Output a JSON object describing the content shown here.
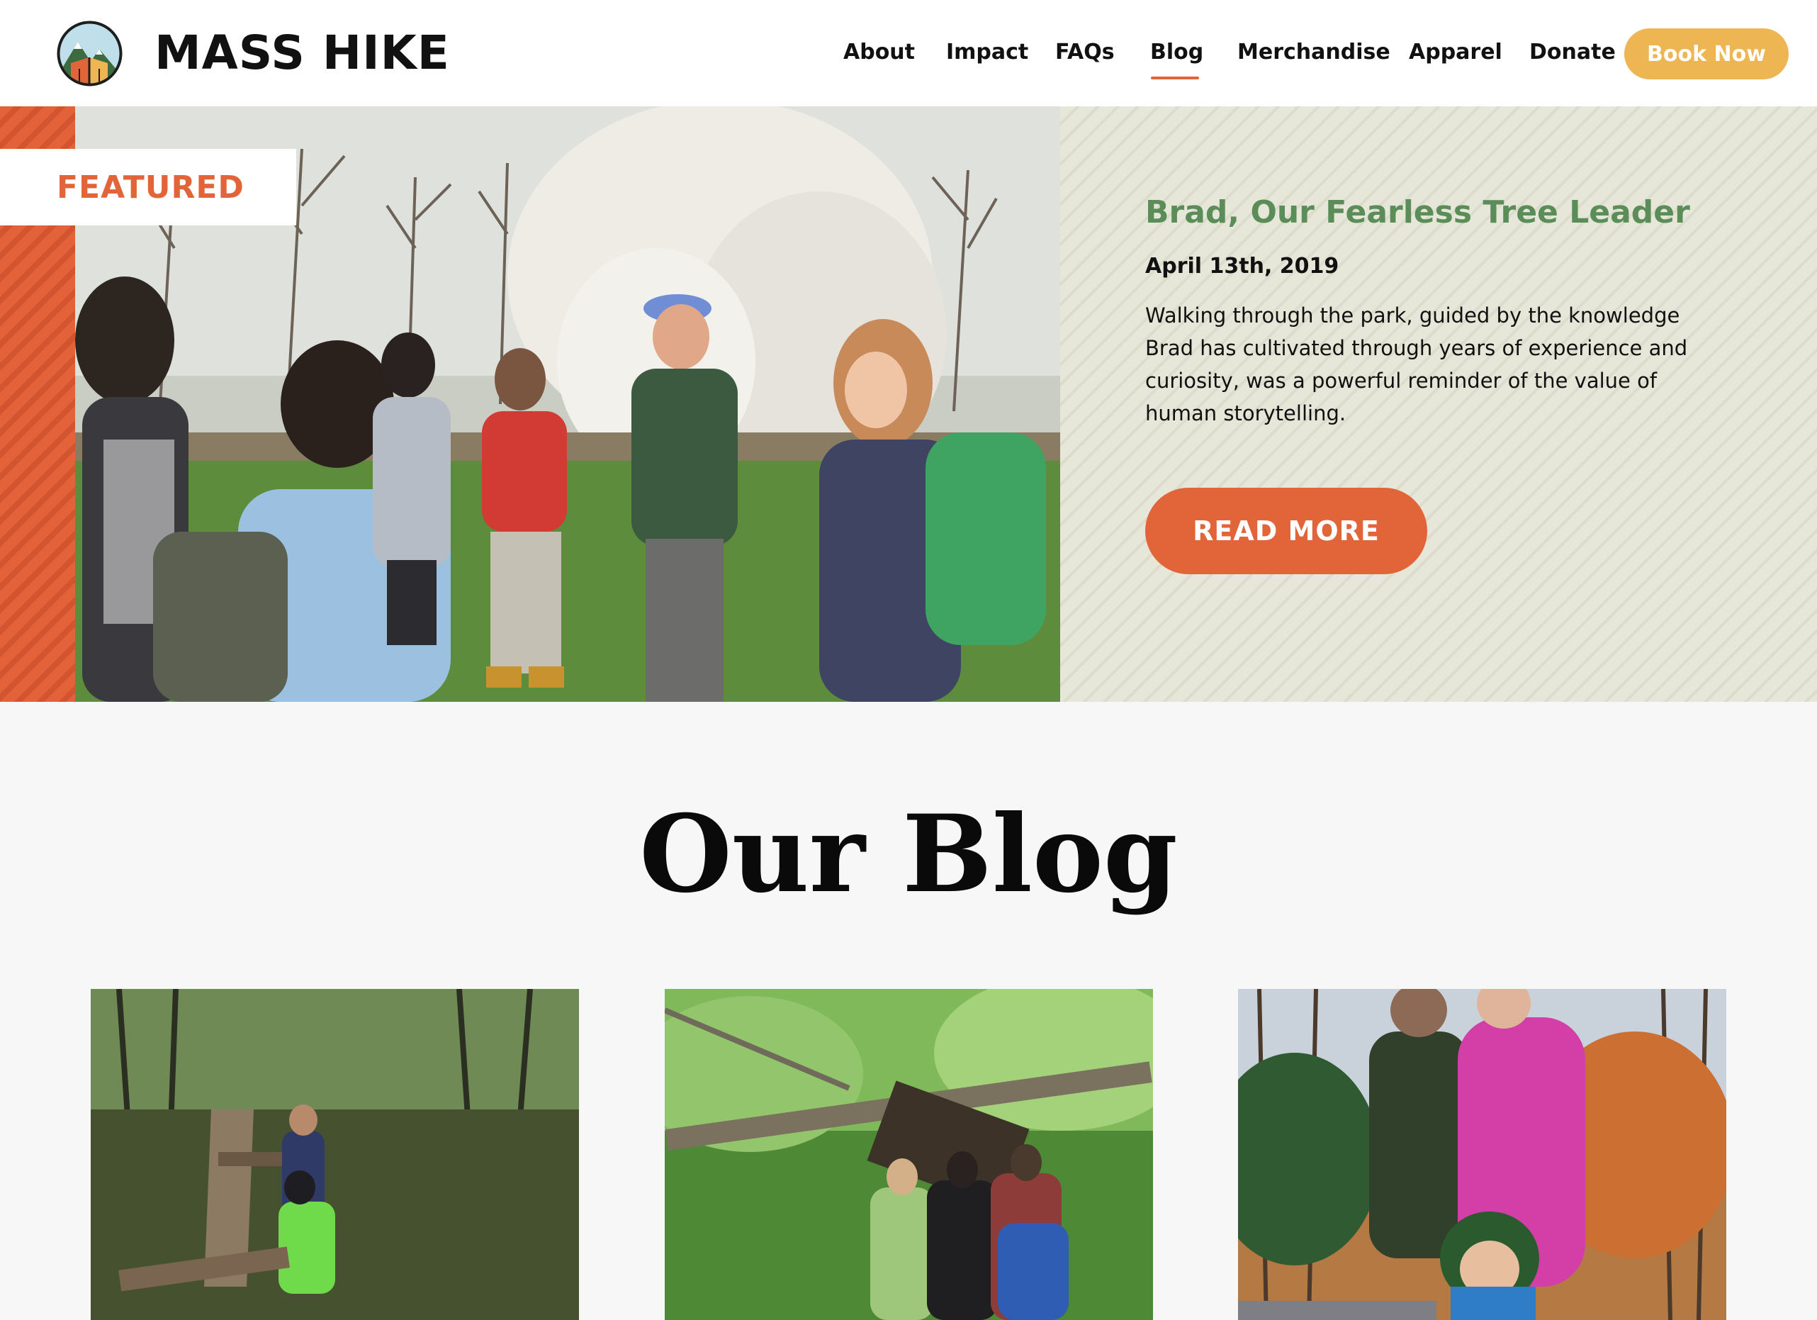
{
  "header": {
    "brand": "MASS HIKE",
    "nav": [
      "About",
      "Impact",
      "FAQs",
      "Blog",
      "Merchandise",
      "Apparel",
      "Donate"
    ],
    "active_item": "Blog",
    "book_button": "Book Now"
  },
  "featured": {
    "tag": "FEATURED",
    "title": "Brad, Our Fearless Tree Leader",
    "date": "April 13th, 2019",
    "excerpt": "Walking through the park, guided by the knowledge Brad has cultivated through years of experience and curiosity, was a powerful reminder of the value of human storytelling.",
    "button": "READ MORE"
  },
  "blog": {
    "heading": "Our Blog"
  },
  "colors": {
    "accent_orange": "#e2653a",
    "accent_yellow": "#eeb553",
    "title_green": "#5a8d58",
    "panel_bg": "#e6e6d9",
    "page_bg": "#f7f7f7"
  }
}
